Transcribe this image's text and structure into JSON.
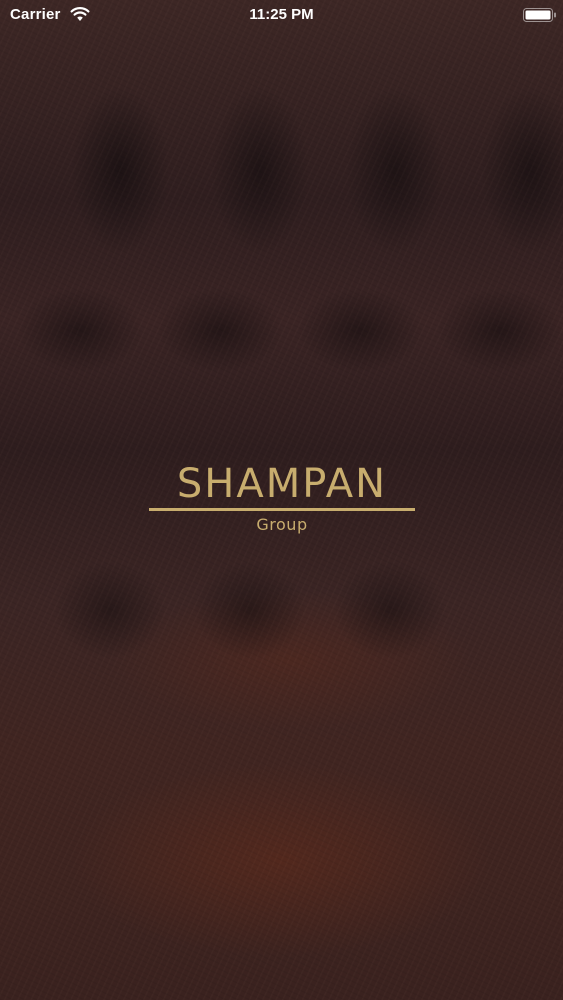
{
  "status_bar": {
    "carrier": "Carrier",
    "time": "11:25 PM",
    "wifi_icon": "wifi-icon",
    "battery_icon": "battery-icon"
  },
  "logo": {
    "name": "SHAMPAN",
    "subtitle": "Group"
  },
  "colors": {
    "gold": "#c8ad6e",
    "background": "#3a2220",
    "status_text": "#ffffff"
  }
}
